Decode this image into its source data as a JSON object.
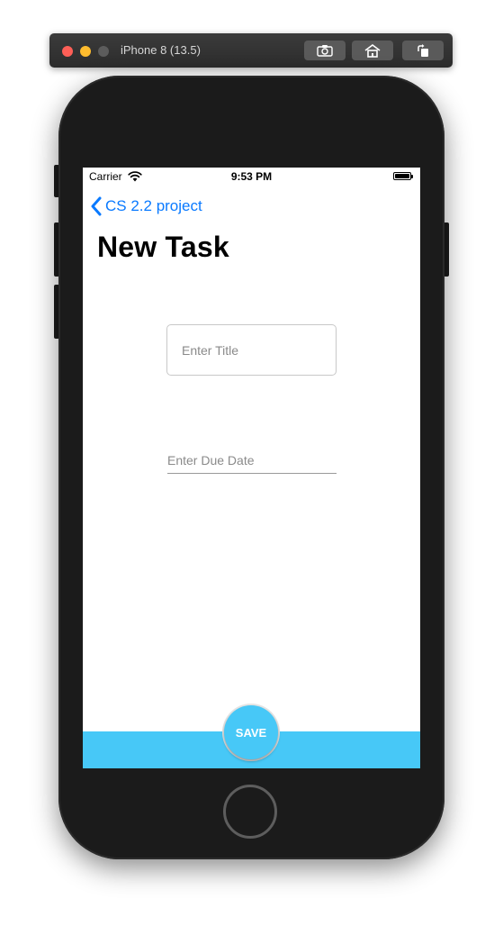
{
  "simulator": {
    "title": "iPhone 8 (13.5)",
    "toolbar": [
      "camera-icon",
      "home-icon",
      "rotate-icon"
    ]
  },
  "status_bar": {
    "carrier": "Carrier",
    "time": "9:53 PM",
    "battery_level": 1.0
  },
  "nav": {
    "back_label": "CS 2.2 project",
    "title": "New Task"
  },
  "form": {
    "title_placeholder": "Enter Title",
    "title_value": "",
    "due_date_placeholder": "Enter Due Date",
    "due_date_value": ""
  },
  "save": {
    "label": "SAVE"
  },
  "colors": {
    "accent_blue": "#0a7aff",
    "save_cyan": "#47c8f7"
  }
}
